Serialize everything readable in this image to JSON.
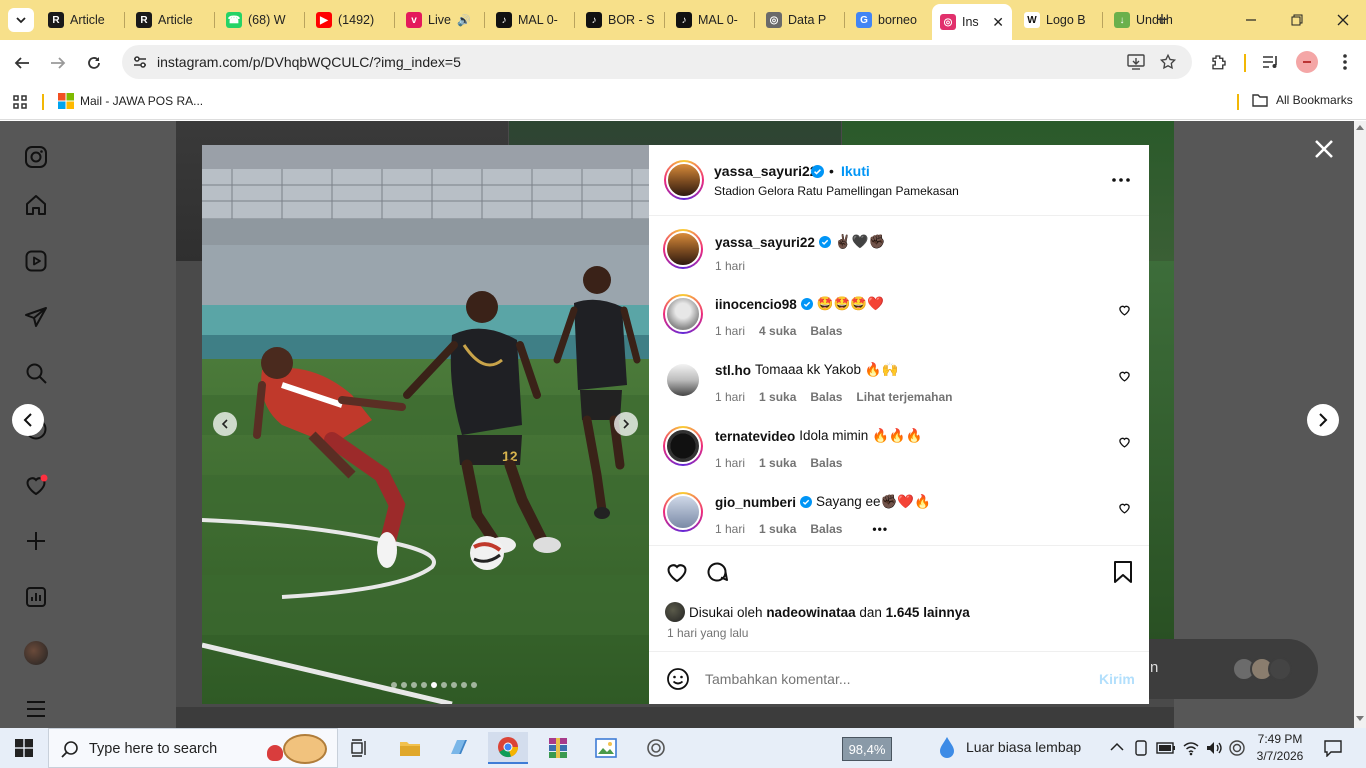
{
  "browser": {
    "tabs": [
      {
        "label": "Article",
        "icon": "ro-icon"
      },
      {
        "label": "Article",
        "icon": "ro-icon"
      },
      {
        "label": "(68) W",
        "icon": "whatsapp-icon"
      },
      {
        "label": "(1492)",
        "icon": "youtube-icon"
      },
      {
        "label": "Live",
        "icon": "vidio-icon"
      },
      {
        "label": "MAL 0-",
        "icon": "tiktok-icon"
      },
      {
        "label": "BOR - S",
        "icon": "tiktok-icon"
      },
      {
        "label": "MAL 0-",
        "icon": "tiktok-icon"
      },
      {
        "label": "Data P",
        "icon": "web-icon"
      },
      {
        "label": "borneo",
        "icon": "google-icon"
      },
      {
        "label": "Ins",
        "icon": "instagram-icon",
        "active": true
      },
      {
        "label": "Logo B",
        "icon": "wikipedia-icon"
      },
      {
        "label": "Unduh",
        "icon": "unduh-icon"
      }
    ],
    "url": "instagram.com/p/DVhqbWQCULC/?img_index=5",
    "bookmarks": {
      "mail": "Mail - JAWA POS RA...",
      "all": "All Bookmarks"
    }
  },
  "post": {
    "author": "yassa_sayuri22",
    "follow_label": "Ikuti",
    "location": "Stadion Gelora Ratu Pamellingan Pamekasan",
    "caption": {
      "name": "yassa_sayuri22",
      "text": "✌🏿🖤✊🏿",
      "time": "1 hari"
    },
    "comments": [
      {
        "name": "iinocencio98",
        "verified": true,
        "text": "🤩🤩🤩❤️",
        "time": "1 hari",
        "likes": "4 suka",
        "reply": "Balas",
        "extra": ""
      },
      {
        "name": "stl.ho",
        "verified": false,
        "text": "Tomaaa kk Yakob 🔥🙌",
        "time": "1 hari",
        "likes": "1 suka",
        "reply": "Balas",
        "extra": "Lihat terjemahan"
      },
      {
        "name": "ternatevideo",
        "verified": false,
        "text": "Idola mimin 🔥🔥🔥",
        "time": "1 hari",
        "likes": "1 suka",
        "reply": "Balas",
        "extra": ""
      },
      {
        "name": "gio_numberi",
        "verified": true,
        "text": "Sayang ee✊🏿❤️🔥",
        "time": "1 hari",
        "likes": "1 suka",
        "reply": "Balas",
        "extra": "•••"
      }
    ],
    "likes_prefix": "Disukai oleh",
    "likes_user": "nadeowinataa",
    "likes_and": "dan",
    "likes_count": "1.645 lainnya",
    "posted": "1 hari yang lalu",
    "comment_placeholder": "Tambahkan komentar...",
    "send_label": "Kirim"
  },
  "photo": {
    "jersey_number": "12"
  },
  "background_peek": {
    "text": "n"
  },
  "taskbar": {
    "search_placeholder": "Type here to search",
    "battery_label": "98,4%",
    "weather": "Luar biasa lembap",
    "time": "7:49 PM",
    "date": "3/7/2026"
  },
  "colors": {
    "tabbar": "#f7e08a",
    "link": "#0095f6",
    "verified": "#0095f6"
  }
}
